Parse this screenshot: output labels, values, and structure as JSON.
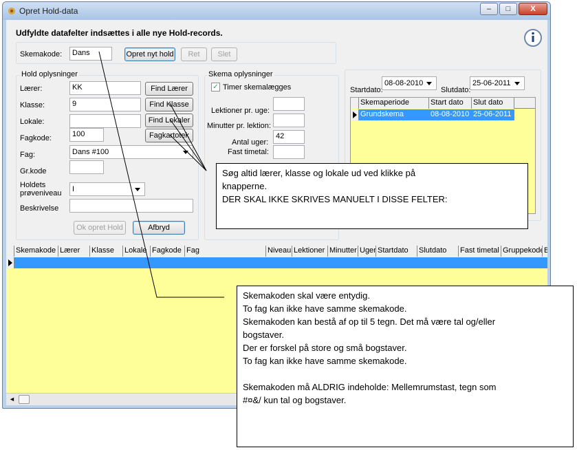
{
  "window": {
    "title": "Opret Hold-data",
    "controls": {
      "minimize": "–",
      "maximize": "□",
      "close": "X"
    }
  },
  "heading": "Udfyldte datafelter indsættes i alle nye Hold-records.",
  "skemakode": {
    "label": "Skemakode:",
    "value": "Dans",
    "buttons": {
      "opret": "Opret nyt hold",
      "ret": "Ret",
      "slet": "Slet"
    }
  },
  "hold": {
    "title": "Hold oplysninger",
    "laerer": {
      "label": "Lærer:",
      "value": "KK",
      "button": "Find Lærer"
    },
    "klasse": {
      "label": "Klasse:",
      "value": "9",
      "button": "Find Klasse"
    },
    "lokale": {
      "label": "Lokale:",
      "value": "",
      "button": "Find Lokaler"
    },
    "fagkode": {
      "label": "Fagkode:",
      "value": "100",
      "button": "Fagkartotek"
    },
    "fag": {
      "label": "Fag:",
      "value": "Dans #100"
    },
    "grkode": {
      "label": "Gr.kode",
      "value": ""
    },
    "niveau": {
      "label_1": "Holdets",
      "label_2": "prøveniveau",
      "value": "I"
    },
    "beskrivelse": {
      "label": "Beskrivelse",
      "value": ""
    },
    "ok_button": "Ok opret Hold",
    "afbryd_button": "Afbryd"
  },
  "skema": {
    "title": "Skema oplysninger",
    "timer_checkbox": "Timer skemalægges",
    "lektioner": {
      "label": "Lektioner pr. uge:",
      "value": ""
    },
    "minutter": {
      "label": "Minutter pr. lektion:",
      "value": ""
    },
    "antal_uger": {
      "label": "Antal uger:",
      "value": "42"
    },
    "fast_timetal": {
      "label": "Fast timetal:",
      "value": ""
    }
  },
  "periode": {
    "startdato_label": "Startdato:",
    "startdato_value": "08-08-2010",
    "slutdato_label": "Slutdato:",
    "slutdato_value": "25-06-2011",
    "columns": [
      "Skemaperiode",
      "Start dato",
      "Slut dato"
    ],
    "rows": [
      {
        "name": "Grundskema",
        "start": "08-08-2010",
        "slut": "25-06-2011"
      }
    ]
  },
  "grid": {
    "columns": [
      "Skemakode",
      "Lærer",
      "Klasse",
      "Lokale",
      "Fagkode",
      "Fag",
      "Niveau",
      "Lektioner",
      "Minutter",
      "Uger",
      "Startdato",
      "Slutdato",
      "Fast timetal",
      "Gruppekode",
      "B"
    ]
  },
  "callout1": {
    "lines": [
      "Søg altid lærer, klasse og lokale ud ved klikke på",
      "knapperne.",
      "DER SKAL IKKE SKRIVES MANUELT I DISSE FELTER:"
    ]
  },
  "callout2": {
    "lines": [
      "Skemakoden skal være entydig.",
      "To fag kan ikke have samme skemakode.",
      "Skemakoden kan bestå af op til 5 tegn. Det må være tal og/eller",
      "bogstaver.",
      "Der er forskel på store og små bogstaver.",
      "To fag kan ikke have samme skemakode.",
      "",
      "Skemakoden må ALDRIG indeholde: Mellemrumstast, tegn som",
      "#¤&/ kun tal og bogstaver."
    ]
  },
  "colors": {
    "selection": "#3399ff",
    "grid_yellow": "#ffff99",
    "title_bar": "#b9d1ea"
  }
}
